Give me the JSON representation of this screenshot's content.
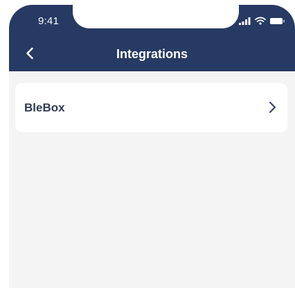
{
  "status_bar": {
    "time": "9:41",
    "icons": [
      "signal-icon",
      "wifi-icon",
      "battery-icon"
    ]
  },
  "nav": {
    "title": "Integrations",
    "back_icon": "chevron-left-icon"
  },
  "integrations": [
    {
      "label": "BleBox",
      "icon": "chevron-right-icon"
    }
  ],
  "colors": {
    "header": "#263a63",
    "background": "#f4f4f4",
    "card": "#ffffff",
    "text_dark": "#2e3b54"
  }
}
